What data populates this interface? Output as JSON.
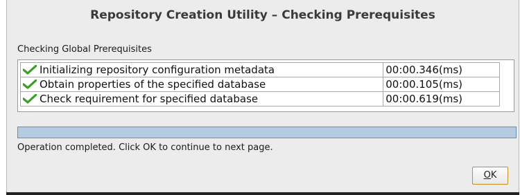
{
  "window": {
    "title": "Repository Creation Utility – Checking Prerequisites"
  },
  "section": {
    "label": "Checking Global Prerequisites"
  },
  "tasks": [
    {
      "status_icon": "check-icon",
      "label": "Initializing repository configuration metadata",
      "time": "00:00.346(ms)"
    },
    {
      "status_icon": "check-icon",
      "label": "Obtain properties of the specified database",
      "time": "00:00.105(ms)"
    },
    {
      "status_icon": "check-icon",
      "label": "Check requirement for specified database",
      "time": "00:00.619(ms)"
    }
  ],
  "progress": {
    "fraction": 1.0
  },
  "status": {
    "message": "Operation completed. Click OK to continue to next page."
  },
  "buttons": {
    "ok_label": "OK",
    "ok_mnemonic": "O"
  },
  "colors": {
    "check": "#3aa024",
    "progress_fill": "#b4cbe0",
    "button_border": "#c98c20"
  }
}
